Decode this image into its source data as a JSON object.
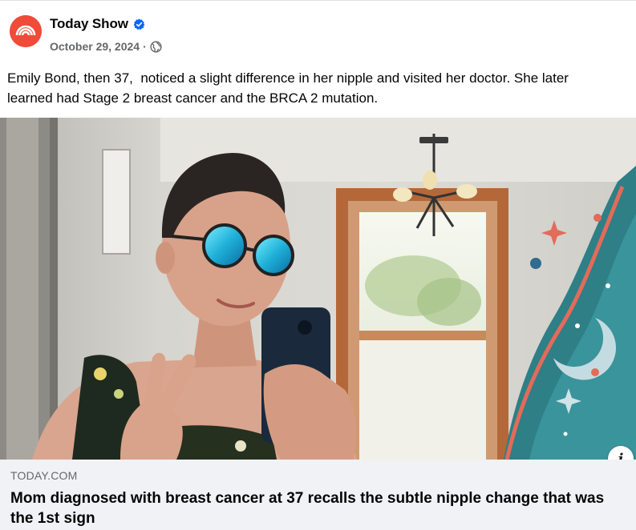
{
  "post": {
    "page_name": "Today Show",
    "verified_icon": "verified-badge-icon",
    "date": "October 29, 2024",
    "separator": "·",
    "audience_icon": "globe-icon",
    "text_lines": [
      "Emily Bond, then 37,  noticed a slight difference in her nipple and visited her doctor. She later",
      "learned had Stage 2 breast cancer and the BRCA 2 mutation."
    ]
  },
  "link_preview": {
    "domain": "TODAY.COM",
    "headline": "Mom diagnosed with breast cancer at 37 recalls the subtle nipple change that was the 1st sign",
    "info_icon": "info-icon",
    "info_glyph": "i"
  },
  "colors": {
    "brand_avatar": "#ef4b38",
    "verified_blue": "#0866ff",
    "secondary_text": "#65676b",
    "card_bg": "#f0f2f5"
  }
}
